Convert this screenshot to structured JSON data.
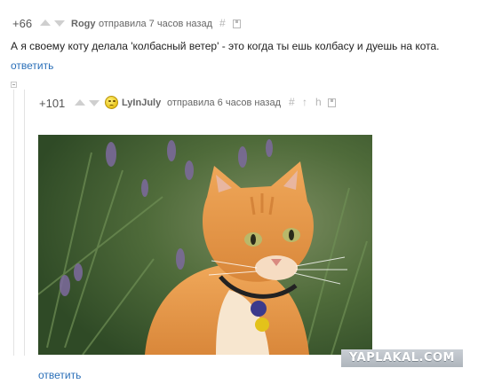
{
  "comment1": {
    "rating": "+66",
    "user": "Rogy",
    "meta": "отправила 7 часов назад",
    "hash": "#",
    "text": "А я своему коту делала 'колбасный ветер' - это когда ты ешь колбасу и дуешь на кота.",
    "reply": "ответить"
  },
  "comment2": {
    "rating": "+101",
    "user": "LyInJuly",
    "meta": "отправила 6 часов назад",
    "hash": "#",
    "tools": [
      "↑",
      "h"
    ],
    "reply": "ответить"
  },
  "watermark": "YAPLAKAL.COM",
  "photo_alt": "ginger cat photo"
}
